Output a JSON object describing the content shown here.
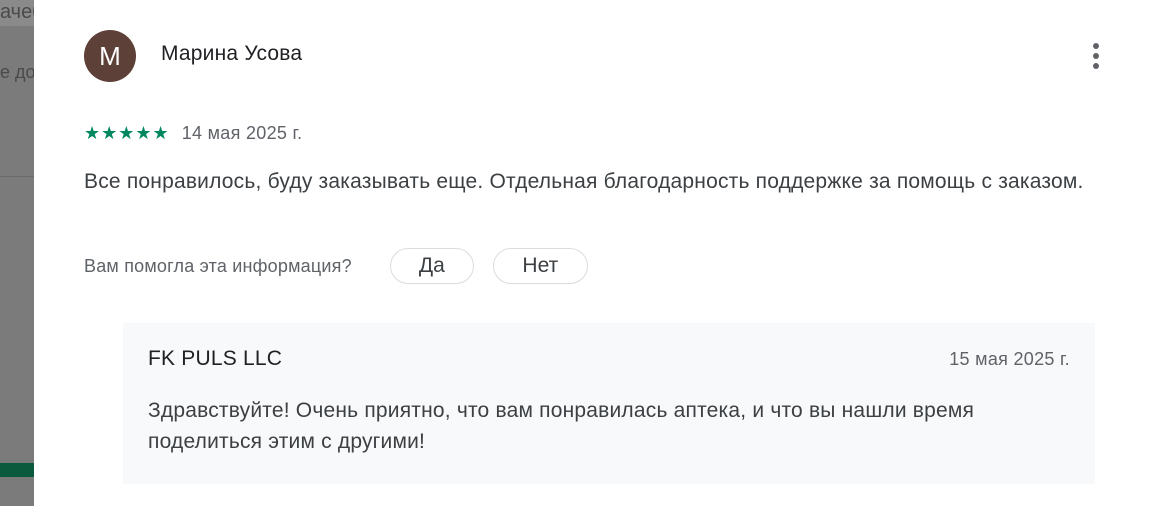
{
  "backdrop": {
    "ghost_line1": "ачеб",
    "ghost_line2": "е до"
  },
  "review": {
    "avatar_letter": "М",
    "author": "Марина Усова",
    "rating": 5,
    "stars": "★★★★★",
    "date": "14 мая 2025 г.",
    "text": "Все понравилось, буду заказывать еще. Отдельная благодарность поддержке за помощь с заказом.",
    "helpful_question": "Вам помогла эта информация?",
    "yes_label": "Да",
    "no_label": "Нет"
  },
  "reply": {
    "author": "FK PULS LLC",
    "date": "15 мая 2025 г.",
    "text": "Здравствуйте! Очень приятно, что вам понравилась аптека, и что вы нашли время поделиться этим с другими!"
  },
  "icons": {
    "more": "more-vert-icon",
    "star": "star-icon"
  },
  "colors": {
    "avatar_bg": "#5d4037",
    "star_color": "#01875f",
    "reply_bg": "#f8f9fa"
  }
}
